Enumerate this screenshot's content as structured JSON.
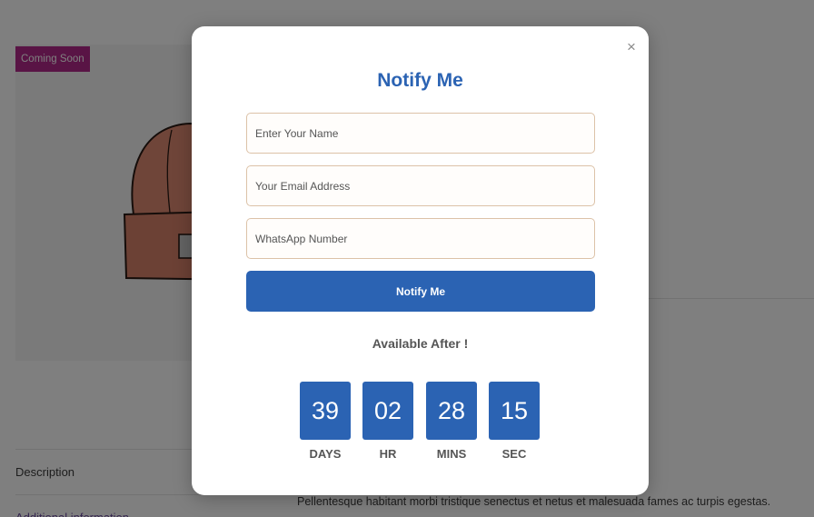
{
  "product": {
    "badge": "Coming Soon",
    "tabs": [
      "Description",
      "Additional information"
    ],
    "description_text": "Pellentesque habitant morbi tristique senectus et netus et malesuada fames ac turpis egestas."
  },
  "modal": {
    "close_symbol": "×",
    "title": "Notify Me",
    "fields": {
      "name_placeholder": "Enter Your Name",
      "email_placeholder": "Your Email Address",
      "whatsapp_placeholder": "WhatsApp Number"
    },
    "button_label": "Notify Me",
    "available_label": "Available After !",
    "countdown": [
      {
        "value": "39",
        "label": "DAYS"
      },
      {
        "value": "02",
        "label": "HR"
      },
      {
        "value": "28",
        "label": "MINS"
      },
      {
        "value": "15",
        "label": "SEC"
      }
    ]
  },
  "colors": {
    "accent": "#2b63b3",
    "badge": "#b3288a",
    "overlay": "rgba(0,0,0,0.5)"
  },
  "icons": {
    "close": "close-icon",
    "product_image": "beanie-hat-illustration"
  }
}
